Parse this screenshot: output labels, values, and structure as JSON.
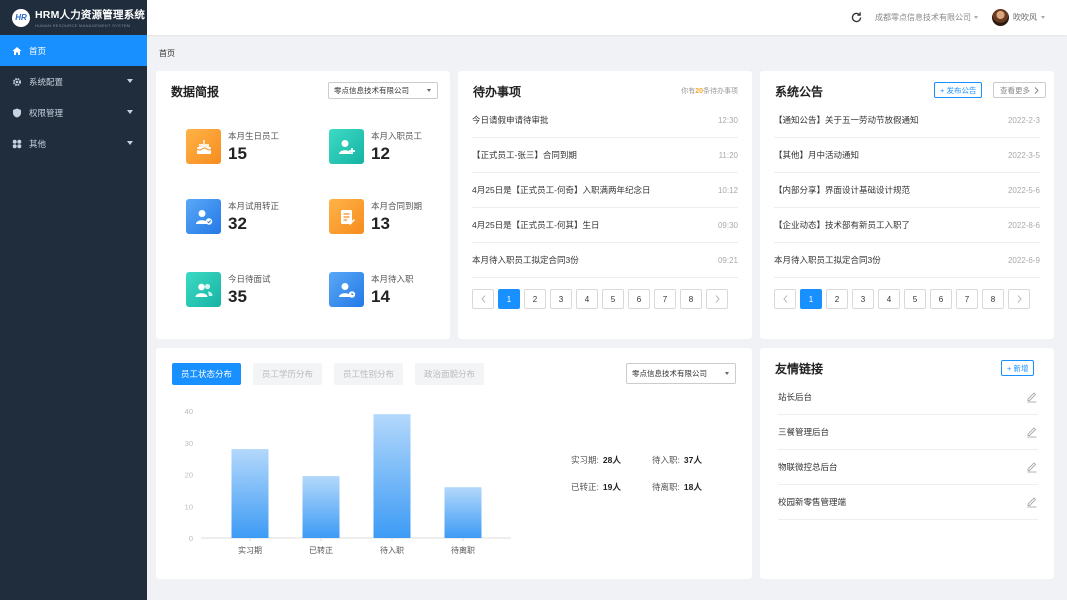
{
  "app": {
    "title": "HRM人力资源管理系统",
    "subtitle": "HUMAN RESOURCE MANAGEMENT SYSTEM",
    "logo_mark": "HR"
  },
  "sidebar": {
    "items": [
      {
        "label": "首页",
        "icon": "home-icon",
        "active": true,
        "has_caret": false
      },
      {
        "label": "系统配置",
        "icon": "gear-icon",
        "active": false,
        "has_caret": true
      },
      {
        "label": "权限管理",
        "icon": "shield-icon",
        "active": false,
        "has_caret": true
      },
      {
        "label": "其他",
        "icon": "grid-icon",
        "active": false,
        "has_caret": true
      }
    ]
  },
  "header": {
    "company": "成都零点信息技术有限公司",
    "username": "吹吹风"
  },
  "breadcrumb": "首页",
  "stats_card": {
    "title": "数据简报",
    "company_select": "零点信息技术有限公司",
    "items": [
      {
        "label": "本月生日员工",
        "value": "15",
        "color": "orange",
        "icon": "cake-icon"
      },
      {
        "label": "本月入职员工",
        "value": "12",
        "color": "teal",
        "icon": "user-add-icon"
      },
      {
        "label": "本月试用转正",
        "value": "32",
        "color": "blue",
        "icon": "user-check-icon"
      },
      {
        "label": "本月合同到期",
        "value": "13",
        "color": "orange",
        "icon": "contract-icon"
      },
      {
        "label": "今日待面试",
        "value": "35",
        "color": "teal",
        "icon": "users-icon"
      },
      {
        "label": "本月待入职",
        "value": "14",
        "color": "blue",
        "icon": "user-clock-icon"
      }
    ]
  },
  "todo_card": {
    "title": "待办事项",
    "count_prefix": "你有",
    "count": "20",
    "count_suffix": "条待办事项",
    "items": [
      {
        "text": "今日请假申请待审批",
        "time": "12:30"
      },
      {
        "text": "【正式员工-张三】合同到期",
        "time": "11:20"
      },
      {
        "text": "4月25日是【正式员工-何奇】入职满两年纪念日",
        "time": "10:12"
      },
      {
        "text": "4月25日是【正式员工-何其】生日",
        "time": "09:30"
      },
      {
        "text": "本月待入职员工拟定合同3份",
        "time": "09:21"
      }
    ],
    "pages": [
      "1",
      "2",
      "3",
      "4",
      "5",
      "6",
      "7",
      "8"
    ],
    "active_page": "1"
  },
  "notice_card": {
    "title": "系统公告",
    "publish_label": "+ 发布公告",
    "more_label": "查看更多",
    "items": [
      {
        "text": "【通知公告】关于五一劳动节放假通知",
        "date": "2022-2-3"
      },
      {
        "text": "【其他】月中活动通知",
        "date": "2022-3-5"
      },
      {
        "text": "【内部分享】界面设计基础设计规范",
        "date": "2022-5-6"
      },
      {
        "text": "【企业动态】技术部有新员工入职了",
        "date": "2022-8-6"
      },
      {
        "text": "本月待入职员工拟定合同3份",
        "date": "2022-6-9"
      }
    ],
    "pages": [
      "1",
      "2",
      "3",
      "4",
      "5",
      "6",
      "7",
      "8"
    ],
    "active_page": "1"
  },
  "chart_card": {
    "tabs": [
      {
        "label": "员工状态分布",
        "active": true
      },
      {
        "label": "员工学历分布",
        "active": false
      },
      {
        "label": "员工性别分布",
        "active": false
      },
      {
        "label": "政治面貌分布",
        "active": false
      }
    ],
    "company_select": "零点信息技术有限公司",
    "summary": [
      {
        "label": "实习期:",
        "value": "28人"
      },
      {
        "label": "待入职:",
        "value": "37人"
      },
      {
        "label": "已转正:",
        "value": "19人"
      },
      {
        "label": "待离职:",
        "value": "18人"
      }
    ]
  },
  "chart_data": {
    "type": "bar",
    "categories": [
      "实习期",
      "已转正",
      "待入职",
      "待离职"
    ],
    "values": [
      28,
      19.5,
      39,
      16
    ],
    "ylim": [
      0,
      40
    ],
    "yticks": [
      0,
      10,
      20,
      30,
      40
    ],
    "grid": false,
    "legend": "none",
    "bar_color_top": "#b3d8fb",
    "bar_color_bottom": "#3d9bf5"
  },
  "links_card": {
    "title": "友情链接",
    "add_label": "+ 新增",
    "items": [
      "站长后台",
      "三餐管理后台",
      "物联微控总后台",
      "校园新零售管理端"
    ]
  },
  "colors": {
    "primary": "#1890ff",
    "sidebar_bg": "#1f2d3d",
    "accent_orange": "#f5a623"
  }
}
